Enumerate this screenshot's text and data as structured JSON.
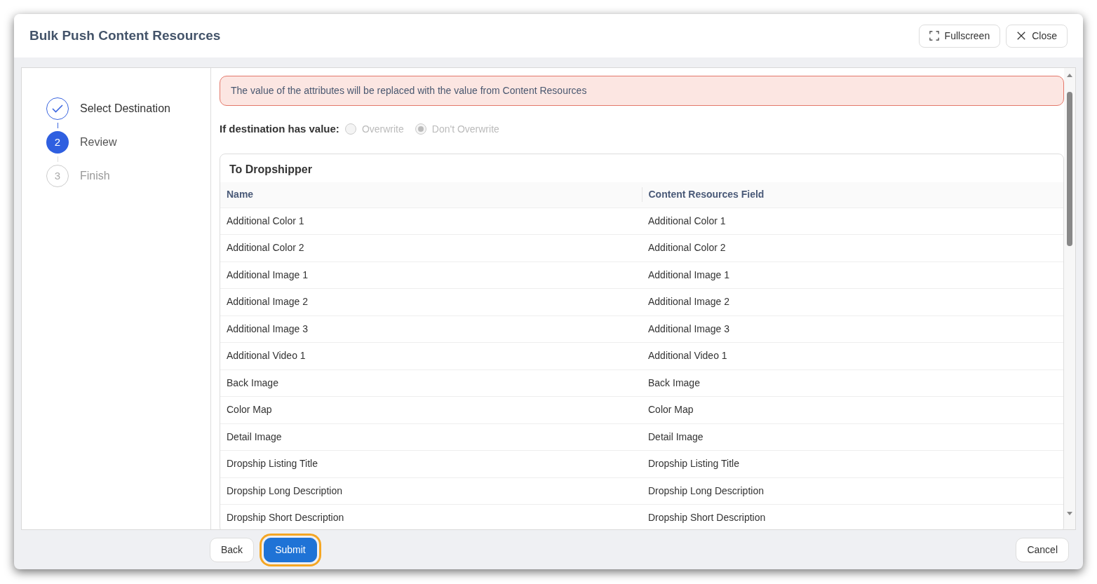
{
  "dialog": {
    "title": "Bulk Push Content Resources",
    "header_buttons": [
      {
        "kind": "fullscreen",
        "label": "Fullscreen"
      },
      {
        "kind": "close",
        "label": "Close"
      }
    ]
  },
  "steps": [
    {
      "label": "Select Destination",
      "completed": true,
      "selected": false
    },
    {
      "number": "2",
      "label": "Review",
      "completed": false,
      "selected": true
    },
    {
      "number": "3",
      "label": "Finish",
      "completed": false,
      "selected": false
    }
  ],
  "alert": "The value of the attributes will be replaced with the value from Content Resources",
  "option": {
    "label": "If destination has value:",
    "disabled": true,
    "choices": [
      {
        "label": "Overwrite",
        "selected": false
      },
      {
        "label": "Don't Overwrite",
        "selected": true
      }
    ]
  },
  "table": {
    "title": "To Dropshipper",
    "columns": [
      "Name",
      "Content Resources Field"
    ],
    "rows": [
      [
        "Additional Color 1",
        "Additional Color 1"
      ],
      [
        "Additional Color 2",
        "Additional Color 2"
      ],
      [
        "Additional Image 1",
        "Additional Image 1"
      ],
      [
        "Additional Image 2",
        "Additional Image 2"
      ],
      [
        "Additional Image 3",
        "Additional Image 3"
      ],
      [
        "Additional Video 1",
        "Additional Video 1"
      ],
      [
        "Back Image",
        "Back Image"
      ],
      [
        "Color Map",
        "Color Map"
      ],
      [
        "Detail Image",
        "Detail Image"
      ],
      [
        "Dropship Listing Title",
        "Dropship Listing Title"
      ],
      [
        "Dropship Long Description",
        "Dropship Long Description"
      ],
      [
        "Dropship Short Description",
        "Dropship Short Description"
      ]
    ]
  },
  "footer": {
    "buttons": [
      {
        "label": "Back",
        "kind": "secondary",
        "highlighted": false
      },
      {
        "label": "Submit",
        "kind": "primary",
        "highlighted": true
      }
    ],
    "cancel": "Cancel"
  }
}
